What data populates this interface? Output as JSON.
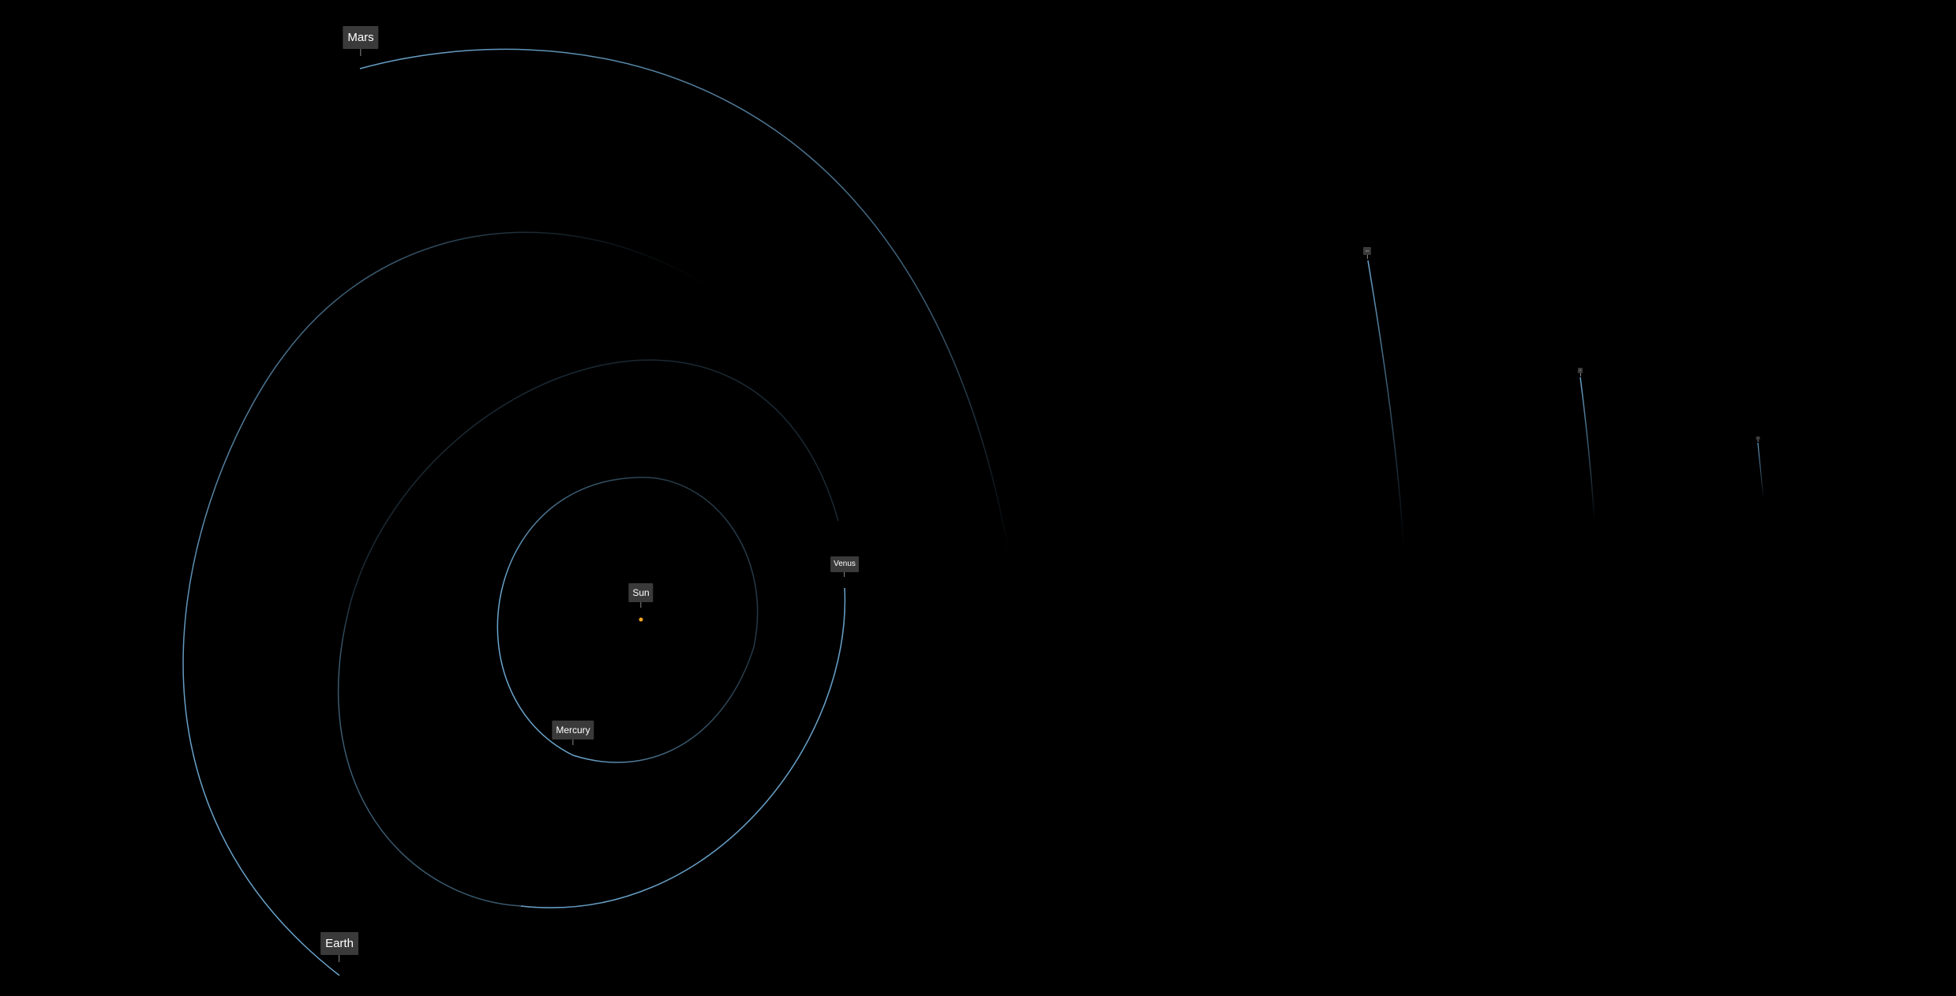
{
  "scene": {
    "background": "#000000",
    "orbit_color": "#6aa4cc",
    "sun_color": "#f5a623",
    "label_bg": "#3a3a3a",
    "label_text_color": "#ffffff"
  },
  "bodies": {
    "sun": {
      "label": "Sun"
    },
    "mercury": {
      "label": "Mercury"
    },
    "venus": {
      "label": "Venus"
    },
    "earth": {
      "label": "Earth"
    },
    "mars": {
      "label": "Mars"
    },
    "far_1": {
      "label": "•••"
    },
    "far_2": {
      "label": "••"
    },
    "far_3": {
      "label": "•"
    }
  }
}
